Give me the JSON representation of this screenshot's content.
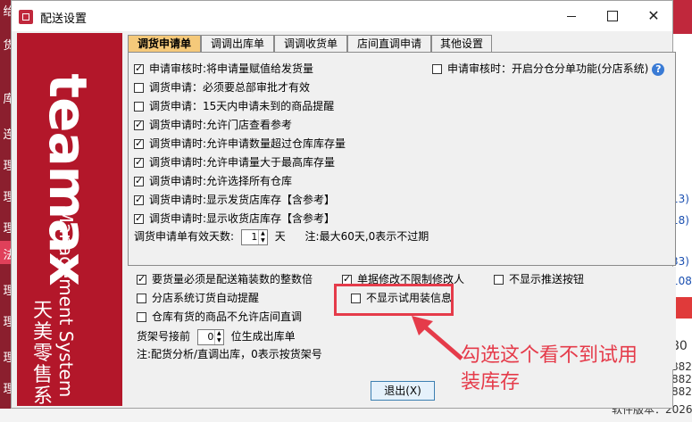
{
  "background": {
    "left_items": [
      "给",
      "货",
      "库",
      "连",
      "理",
      "理",
      "理",
      "法",
      "理",
      "理",
      "理",
      "理"
    ],
    "right_items": [
      "13)",
      "18)",
      "33)",
      "108)",
      "80",
      "882",
      "882",
      "882",
      "868"
    ],
    "version": "软件版本：2026"
  },
  "window": {
    "title": "配送设置",
    "minimize": "—",
    "maximize": "□",
    "close": "✕"
  },
  "brand": {
    "logo": "teamax",
    "subtitle": "Management System",
    "name_cn": "天美零售系统"
  },
  "tabs": [
    {
      "label": "调货申请单",
      "active": true
    },
    {
      "label": "调调出库单",
      "active": false
    },
    {
      "label": "调调收货单",
      "active": false
    },
    {
      "label": "店间直调申请",
      "active": false
    },
    {
      "label": "其他设置",
      "active": false
    }
  ],
  "options": [
    {
      "label": "申请审核时:将申请量赋值给发货量",
      "checked": true
    },
    {
      "label": "调货申请：必须要总部审批才有效",
      "checked": false
    },
    {
      "label": "调货申请：15天内申请未到的商品提醒",
      "checked": false
    },
    {
      "label": "调货申请时:允许门店查看参考",
      "checked": true
    },
    {
      "label": "调货申请时:允许申请数量超过仓库库存量",
      "checked": true
    },
    {
      "label": "调货申请时:允许申请量大于最高库存量",
      "checked": true
    },
    {
      "label": "调货申请时:允许选择所有仓库",
      "checked": true
    },
    {
      "label": "调货申请时:显示发货店库存【含参考】",
      "checked": true
    },
    {
      "label": "调货申请时:显示收货店库存【含参考】",
      "checked": true
    }
  ],
  "right_option": {
    "label": "申请审核时：开启分仓分单功能(分店系统)",
    "checked": false,
    "help": "?"
  },
  "valid_days": {
    "label": "调货申请单有效天数:",
    "value": "1",
    "unit": "天",
    "note": "注:最大60天,0表示不过期"
  },
  "bottom_options": {
    "a": {
      "label": "要货量必须是配送箱装数的整数倍",
      "checked": true
    },
    "b": {
      "label": "单据修改不限制修改人",
      "checked": true
    },
    "c": {
      "label": "不显示推送按钮",
      "checked": false
    },
    "d": {
      "label": "分店系统订货自动提醒",
      "checked": false
    },
    "e": {
      "label": "不显示试用装信息",
      "checked": false
    },
    "f": {
      "label": "仓库有货的商品不允许店间直调",
      "checked": false
    }
  },
  "shelf": {
    "label_prefix": "货架号接前",
    "value": "0",
    "label_suffix": "位生成出库单",
    "note": "注:配货分析/直调出库，0表示按货架号"
  },
  "annotation": {
    "line1": "勾选这个看不到试用",
    "line2": "装库存"
  },
  "exit_button": "退出(X)"
}
